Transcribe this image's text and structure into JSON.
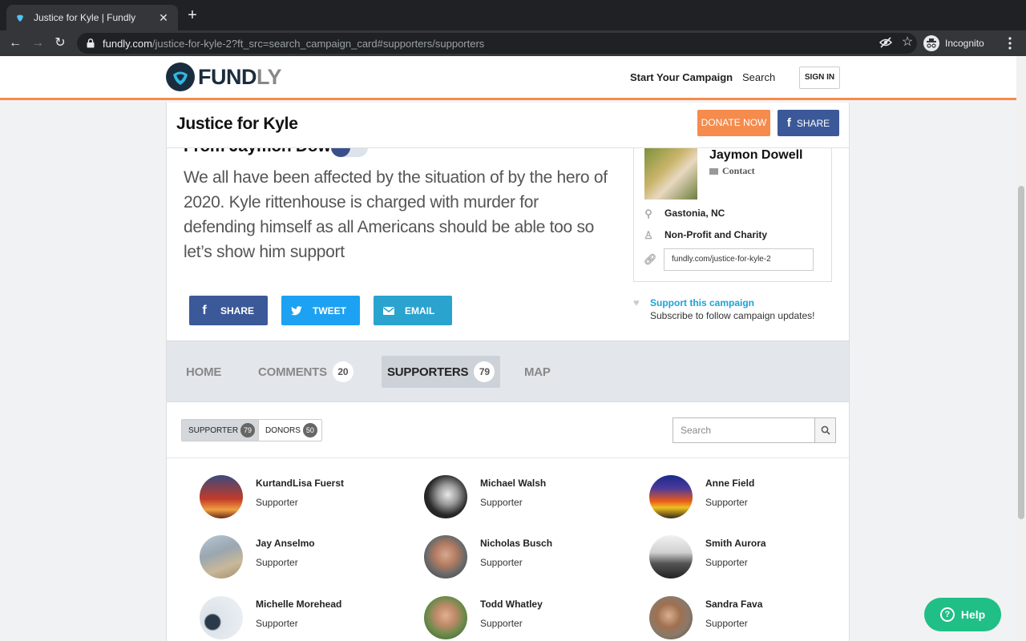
{
  "browser": {
    "tab_title": "Justice for Kyle | Fundly",
    "url_host": "fundly.com",
    "url_path": "/justice-for-kyle-2?ft_src=search_campaign_card#supporters/supporters",
    "profile_label": "Incognito"
  },
  "header": {
    "logo_part1": "FUND",
    "logo_part2": "LY",
    "start_campaign": "Start Your Campaign",
    "search": "Search",
    "sign_in": "SIGN IN"
  },
  "campaign": {
    "title": "Justice for Kyle",
    "donate_label": "DONATE NOW",
    "share_label": "SHARE",
    "from_line": "From Jaymon Dowell",
    "story": "We all have been affected by the situation of by the hero of 2020. Kyle rittenhouse is charged with murder for defending himself as all Americans should be able too so let’s show him support",
    "social": {
      "share": "SHARE",
      "tweet": "TWEET",
      "email": "EMAIL"
    }
  },
  "owner": {
    "name": "Jaymon Dowell",
    "contact": "Contact",
    "location": "Gastonia, NC",
    "category": "Non-Profit and Charity",
    "short_url": "fundly.com/justice-for-kyle-2",
    "support_link": "Support this campaign",
    "support_sub": "Subscribe to follow campaign updates!"
  },
  "page_tabs": [
    {
      "label": "HOME",
      "count": null
    },
    {
      "label": "COMMENTS",
      "count": "20"
    },
    {
      "label": "SUPPORTERS",
      "count": "79"
    },
    {
      "label": "MAP",
      "count": null
    }
  ],
  "filters": [
    {
      "label": "SUPPORTER",
      "count": "79"
    },
    {
      "label": "DONORS",
      "count": "50"
    }
  ],
  "supporter_search_placeholder": "Search",
  "supporters": [
    {
      "name": "KurtandLisa Fuerst",
      "role": "Supporter"
    },
    {
      "name": "Michael Walsh",
      "role": "Supporter"
    },
    {
      "name": "Anne Field",
      "role": "Supporter"
    },
    {
      "name": "Jay Anselmo",
      "role": "Supporter"
    },
    {
      "name": "Nicholas Busch",
      "role": "Supporter"
    },
    {
      "name": "Smith Aurora",
      "role": "Supporter"
    },
    {
      "name": "Michelle Morehead",
      "role": "Supporter"
    },
    {
      "name": "Todd Whatley",
      "role": "Supporter"
    },
    {
      "name": "Sandra Fava",
      "role": "Supporter"
    }
  ],
  "help_label": "Help",
  "colors": {
    "brand_orange": "#f58b4c",
    "facebook_blue": "#3b5998",
    "twitter_blue": "#1da1f2",
    "link_blue": "#1ba3d8",
    "help_green": "#1fbf86"
  }
}
